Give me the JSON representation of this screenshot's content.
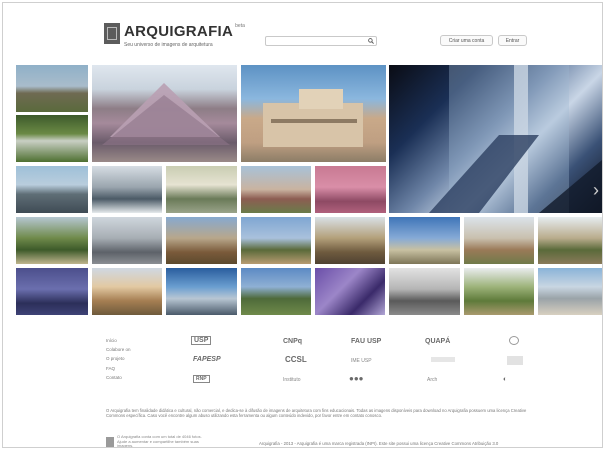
{
  "header": {
    "logo_title": "ARQUIGRAFIA",
    "logo_beta": "beta",
    "logo_subtitle": "Seu universo de imagens de arquitetura",
    "search_placeholder": "",
    "create_account_label": "Criar uma conta",
    "login_label": "Entrar"
  },
  "footer": {
    "links": [
      "Início",
      "Colabore on",
      "O projeto",
      "FAQ",
      "Contato"
    ],
    "partners": [
      "USP",
      "CNPq",
      "FAU USP",
      "QUAPÁ",
      "FAPESP",
      "CCSL",
      "IME USP",
      "RNP",
      "Instituto",
      "Arch"
    ],
    "disclaimer": "O Arquigrafia tem finalidade didática e cultural, não comercial, e dedica-se à difusão de imagens de arquitetura com fins educacionais. Todas as imagens disponíveis para download no Arquigrafia possuem uma licença Creative Commons específica. Caso você encontre algum abuso utilizando esta ferramenta ou algum conteúdo indevido, por favor entre em contato conosco.",
    "footnote": "O Arquigrafia conta com um total de 4046 fotos. Ajude a aumentar e compartilhe também suas imagens.",
    "copyright": "Arquigrafia - 2013 - Arquigrafia é uma marca registrada (INPI). Este site possui uma licença Creative Commons Atribuição 3.0"
  },
  "colors": {
    "accent": "#333333",
    "carousel_bg": "#0c0c12"
  }
}
